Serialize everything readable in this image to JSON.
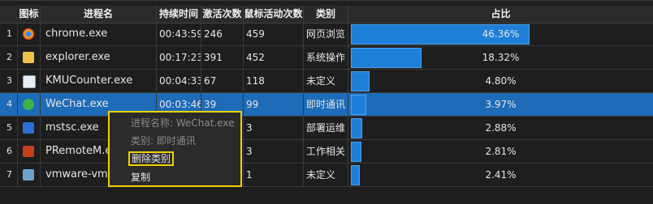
{
  "headers": {
    "icon": "图标",
    "name": "进程名",
    "duration": "持续时间",
    "activations": "激活次数",
    "mouse": "鼠标活动次数",
    "category": "类别",
    "ratio": "占比"
  },
  "rows": [
    {
      "idx": "1",
      "icon": "chrome-icon",
      "name": "chrome.exe",
      "duration": "00:43:59",
      "activations": "246",
      "mouse": "459",
      "category": "网页浏览",
      "percent": "46.36%",
      "ratio": 0.4636
    },
    {
      "idx": "2",
      "icon": "folder-icon",
      "name": "explorer.exe",
      "duration": "00:17:23",
      "activations": "391",
      "mouse": "452",
      "category": "系统操作",
      "percent": "18.32%",
      "ratio": 0.1832
    },
    {
      "idx": "3",
      "icon": "document-icon",
      "name": "KMUCounter.exe",
      "duration": "00:04:33",
      "activations": "67",
      "mouse": "118",
      "category": "未定义",
      "percent": "4.80%",
      "ratio": 0.048
    },
    {
      "idx": "4",
      "icon": "wechat-icon",
      "name": "WeChat.exe",
      "duration": "00:03:46",
      "activations": "39",
      "mouse": "99",
      "category": "即时通讯",
      "percent": "3.97%",
      "ratio": 0.0397
    },
    {
      "idx": "5",
      "icon": "remote-desktop-icon",
      "name": "mstsc.exe",
      "duration": "",
      "activations": "",
      "mouse": "3",
      "category": "部署运维",
      "percent": "2.88%",
      "ratio": 0.0288
    },
    {
      "idx": "6",
      "icon": "powerpoint-icon",
      "name": "PRemoteM.exe",
      "duration": "",
      "activations": "",
      "mouse": "3",
      "category": "工作相关",
      "percent": "2.81%",
      "ratio": 0.0281
    },
    {
      "idx": "7",
      "icon": "vmware-icon",
      "name": "vmware-vmx.exe",
      "duration": "",
      "activations": "",
      "mouse": "1",
      "category": "未定义",
      "percent": "2.41%",
      "ratio": 0.0241
    }
  ],
  "context_menu": {
    "process_label": "进程名称: WeChat.exe",
    "category_label": "类别: 即时通讯",
    "delete_category": "删除类别",
    "copy": "复制"
  }
}
